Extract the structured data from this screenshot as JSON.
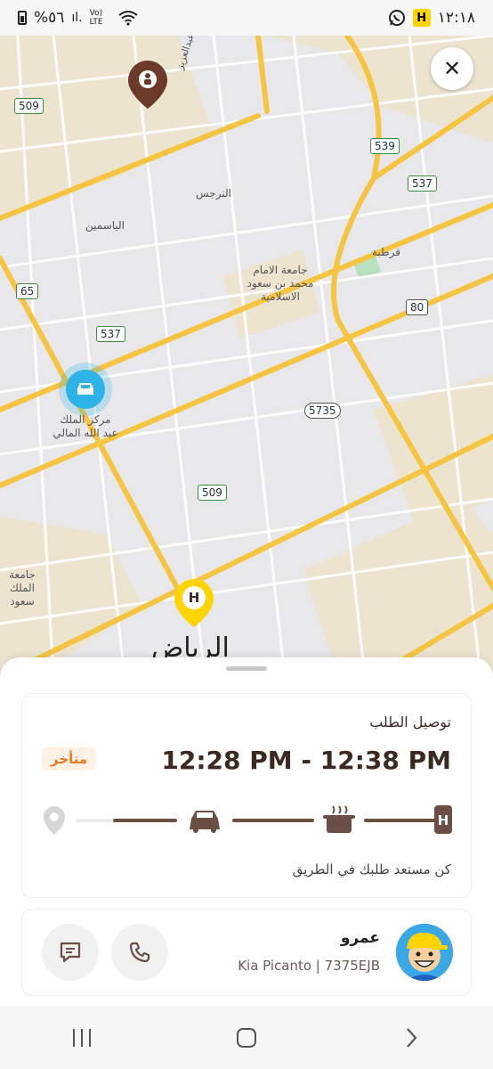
{
  "status_bar": {
    "time": "١٢:١٨",
    "app_badge": "H",
    "battery_text": "%٥٦",
    "network_text": "Vo) LTE"
  },
  "map": {
    "close_label": "✕",
    "labels": [
      "الياسمين",
      "النرجس",
      "قرطبة",
      "جامعة الامام محمد بن سعود الاسلامية",
      "مركز الملك عبد الله المالي",
      "جامعة الملك سعود",
      "طريق الملك سلمان بن عبدالعزيز"
    ],
    "city_label": "الرياض",
    "shields": [
      "509",
      "539",
      "537",
      "65",
      "537",
      "80",
      "5735",
      "509"
    ],
    "restaurant_badge": "H",
    "colors": {
      "driver_marker": "#2eb3e8",
      "destination_marker": "#6b3a2a",
      "restaurant_marker": "#ffd400",
      "highway": "#f5c542"
    }
  },
  "order": {
    "title": "توصيل الطلب",
    "eta": "12:28 PM - 12:38 PM",
    "late_badge": "متأخر",
    "status_message": "كن مستعد طلبك في الطريق",
    "progress_icons": [
      "pin-icon",
      "car-icon",
      "food-pot-icon",
      "restaurant-icon"
    ]
  },
  "driver": {
    "name": "عمرو",
    "car": "Kia Picanto | 7375EJB"
  }
}
